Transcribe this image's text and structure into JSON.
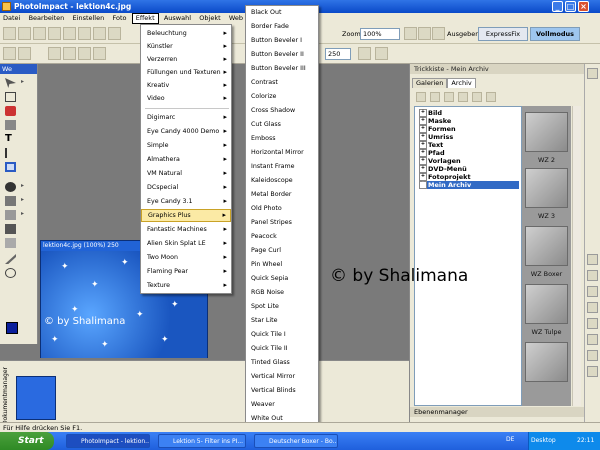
{
  "window": {
    "title": "PhotoImpact - lektion4c.jpg"
  },
  "menubar": [
    "Datei",
    "Bearbeiten",
    "Einstellen",
    "Foto",
    "Effekt",
    "Auswahl",
    "Objekt",
    "Web"
  ],
  "toolbar": {
    "zoom_label": "Zoom",
    "zoom_value": "100%",
    "ausgeben_label": "Ausgeben",
    "expressfix_label": "ExpressFix",
    "vollmodus_label": "Vollmodus",
    "size_value": "250"
  },
  "left_panel": {
    "title": "We"
  },
  "effekt_menu": {
    "items": [
      {
        "label": "Beleuchtung",
        "sub": true
      },
      {
        "label": "Künstler",
        "sub": true
      },
      {
        "label": "Verzerren",
        "sub": true
      },
      {
        "label": "Füllungen und Texturen",
        "sub": true
      },
      {
        "label": "Kreativ",
        "sub": true
      },
      {
        "label": "Video",
        "sub": true
      },
      {
        "label": "Digimarc",
        "sub": true
      },
      {
        "label": "Eye Candy 4000 Demo",
        "sub": true
      },
      {
        "label": "Simple",
        "sub": true
      },
      {
        "label": "Almathera",
        "sub": true
      },
      {
        "label": "VM Natural",
        "sub": true
      },
      {
        "label": "DCspecial",
        "sub": true
      },
      {
        "label": "Eye Candy 3.1",
        "sub": true
      },
      {
        "label": "Graphics Plus",
        "sub": true
      },
      {
        "label": "Fantastic Machines",
        "sub": true
      },
      {
        "label": "Alien Skin Splat LE",
        "sub": true
      },
      {
        "label": "Two Moon",
        "sub": true
      },
      {
        "label": "Flaming Pear",
        "sub": true
      },
      {
        "label": "Texture",
        "sub": true
      }
    ]
  },
  "graphics_plus_submenu": {
    "items": [
      "Black Out",
      "Border Fade",
      "Button Beveler I",
      "Button Beveler II",
      "Button Beveler III",
      "Contrast",
      "Colorize",
      "Cross Shadow",
      "Cut Glass",
      "Emboss",
      "Horizontal Mirror",
      "Instant Frame",
      "Kaleidoscope",
      "Metal Border",
      "Old Photo",
      "Panel Stripes",
      "Peacock",
      "Page Curl",
      "Pin Wheel",
      "Quick Sepia",
      "RGB Noise",
      "Spot Lite",
      "Star Lite",
      "Quick Tile I",
      "Quick Tile II",
      "Tinted Glass",
      "Vertical Mirror",
      "Vertical Blinds",
      "Weaver",
      "White Out"
    ]
  },
  "image_window": {
    "title": "lektion4c.jpg (100%) 250"
  },
  "watermark": "© by Shalimana",
  "right_panel": {
    "title": "Trickkiste - Mein Archiv",
    "tabs": [
      "Galerien",
      "Archiv"
    ],
    "tree": [
      "Bild",
      "Maske",
      "Formen",
      "Umriss",
      "Text",
      "Pfad",
      "Vorlagen",
      "DVD-Menü",
      "Fotoprojekt",
      "Mein Archiv"
    ],
    "gallery_labels": [
      "WZ 2",
      "WZ 3",
      "WZ Boxer",
      "WZ Tulpe"
    ],
    "layer_manager": "Ebenenmanager"
  },
  "bottom_panel": {
    "label": "Dokumentmanager"
  },
  "statusbar": {
    "text": "Für Hilfe drücken Sie F1."
  },
  "taskbar": {
    "start": "Start",
    "tasks": [
      "PhotoImpact - lektion...",
      "Lektion 5- Filter ins PI...",
      "Deutscher Boxer - Bo..."
    ],
    "lang": "DE",
    "desktop": "Desktop",
    "clock": "22:11"
  }
}
